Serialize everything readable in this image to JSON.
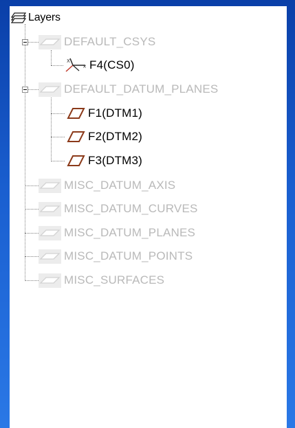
{
  "tree": {
    "root_label": "Layers",
    "root_icon": "layers-stack-icon",
    "groups": [
      {
        "label": "DEFAULT_CSYS",
        "icon": "layer-parallelogram-icon",
        "expanded": true,
        "children": [
          {
            "label": "F4(CS0)",
            "icon": "coordinate-system-icon"
          }
        ]
      },
      {
        "label": "DEFAULT_DATUM_PLANES",
        "icon": "layer-parallelogram-icon",
        "expanded": true,
        "children": [
          {
            "label": "F1(DTM1)",
            "icon": "datum-plane-icon"
          },
          {
            "label": "F2(DTM2)",
            "icon": "datum-plane-icon"
          },
          {
            "label": "F3(DTM3)",
            "icon": "datum-plane-icon"
          }
        ]
      },
      {
        "label": "MISC_DATUM_AXIS",
        "icon": "layer-parallelogram-icon",
        "expanded": false,
        "children": []
      },
      {
        "label": "MISC_DATUM_CURVES",
        "icon": "layer-parallelogram-icon",
        "expanded": false,
        "children": []
      },
      {
        "label": "MISC_DATUM_PLANES",
        "icon": "layer-parallelogram-icon",
        "expanded": false,
        "children": []
      },
      {
        "label": "MISC_DATUM_POINTS",
        "icon": "layer-parallelogram-icon",
        "expanded": false,
        "children": []
      },
      {
        "label": "MISC_SURFACES",
        "icon": "layer-parallelogram-icon",
        "expanded": false,
        "children": []
      }
    ]
  },
  "colors": {
    "background_top": "#0a3fa8",
    "background_bottom": "#2a78e6",
    "panel": "#ffffff",
    "dim_text": "#b9b9b9",
    "active_text": "#000000",
    "datum_plane": "#8b3a1a",
    "csys_red": "#c0392b"
  }
}
